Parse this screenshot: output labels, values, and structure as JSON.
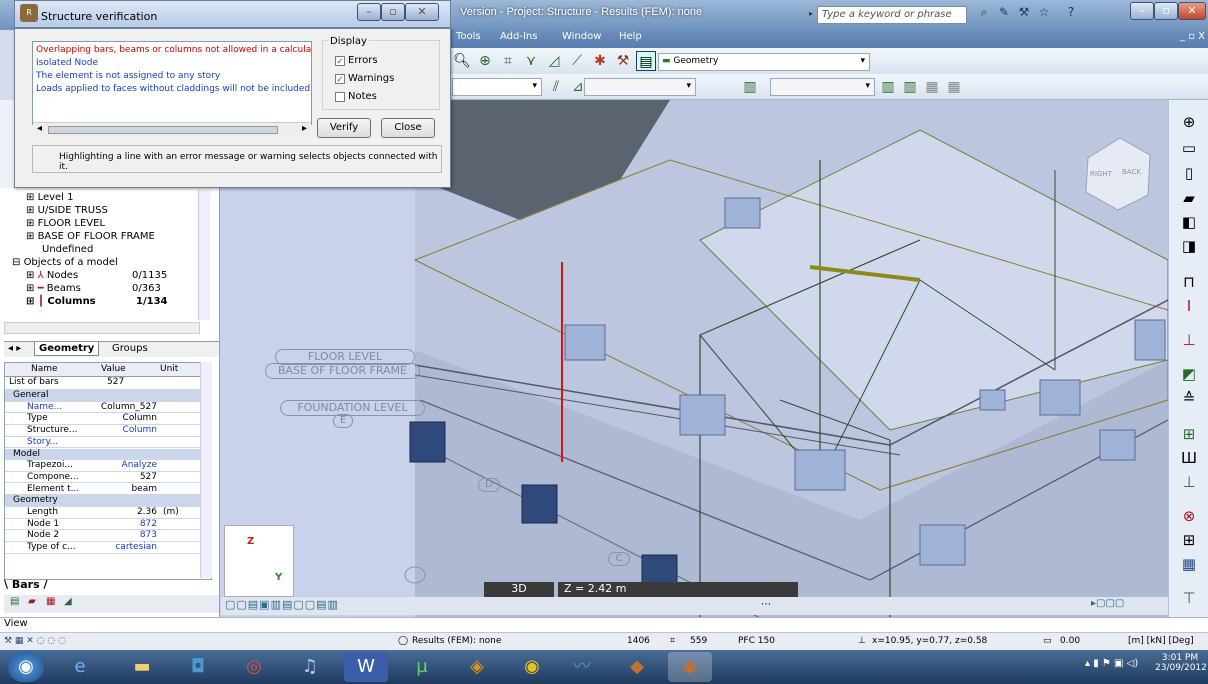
{
  "app": {
    "title": "Version - Project: Structure - Results (FEM): none",
    "search_placeholder": "Type a keyword or phrase"
  },
  "menubar": {
    "items": [
      "Tools",
      "Add-Ins",
      "Window",
      "Help"
    ],
    "mdi_controls": "_ ▫ X"
  },
  "toolbar": {
    "view_combo": "Geometry"
  },
  "dialog": {
    "title": "Structure verification",
    "messages": [
      {
        "text": "Overlapping bars, beams or columns not allowed in a calculation m",
        "color": "#cc0000"
      },
      {
        "text": "Isolated Node",
        "color": "#1a3cc8"
      },
      {
        "text": "The element is not assigned to any story",
        "color": "#1a3cc8"
      },
      {
        "text": "Loads applied to faces without claddings will not be included in cal",
        "color": "#1a3cc8"
      }
    ],
    "display_label": "Display",
    "options": [
      {
        "label": "Errors",
        "checked": true
      },
      {
        "label": "Warnings",
        "checked": true
      },
      {
        "label": "Notes",
        "checked": false
      }
    ],
    "verify_label": "Verify",
    "close_label": "Close",
    "hint": "Highlighting a line with an error message or warning selects objects connected with it."
  },
  "tree": {
    "stories": [
      "Level 1",
      "U/SIDE TRUSS",
      "FLOOR LEVEL",
      "BASE OF FLOOR FRAME",
      "Undefined"
    ],
    "objects_label": "Objects of a model",
    "objects": [
      {
        "label": "Nodes",
        "value": "0/1135"
      },
      {
        "label": "Beams",
        "value": "0/363"
      },
      {
        "label": "Columns",
        "value": "1/134"
      }
    ],
    "tab_geometry": "Geometry",
    "tab_groups": "Groups"
  },
  "props": {
    "headers": {
      "name": "Name",
      "value": "Value",
      "unit": "Unit"
    },
    "list_label": "List of bars",
    "list_value": "527",
    "rows": [
      {
        "section": "General"
      },
      {
        "name": "Name...",
        "value": "Column_527",
        "unit": ""
      },
      {
        "name": "Type",
        "value": "Column",
        "unit": ""
      },
      {
        "name": "Structure...",
        "value": "Column",
        "unit": ""
      },
      {
        "name": "Story...",
        "value": "",
        "unit": ""
      },
      {
        "section": "Model"
      },
      {
        "name": "Trapezoi...",
        "value": "Analyze",
        "unit": ""
      },
      {
        "name": "Compone...",
        "value": "527",
        "unit": ""
      },
      {
        "name": "Element t...",
        "value": "beam",
        "unit": ""
      },
      {
        "section": "Geometry"
      },
      {
        "name": "Length",
        "value": "2.36",
        "unit": "(m)"
      },
      {
        "name": "Node 1",
        "value": "872",
        "unit": ""
      },
      {
        "name": "Node 2",
        "value": "873",
        "unit": ""
      },
      {
        "name": "Type of c...",
        "value": "cartesian",
        "unit": ""
      }
    ],
    "bars_tab": "Bars"
  },
  "viewport": {
    "mode": "3D",
    "z_level": "Z = 2.42 m",
    "story_labels": [
      "FLOOR LEVEL",
      "BASE OF FLOOR FRAME",
      "FOUNDATION LEVEL"
    ],
    "axis_labels": [
      "E",
      "D",
      "C"
    ],
    "cube_labels": [
      "RIGHT",
      "BACK"
    ],
    "axis": {
      "z": "Z",
      "y": "Y"
    }
  },
  "view_label": "View",
  "status": {
    "results": "Results (FEM): none",
    "node_count": "1406",
    "bar_count": "559",
    "section": "PFC 150",
    "coords": "x=10.95, y=0.77, z=0.58",
    "value": "0.00",
    "units": "[m] [kN] [Deg]"
  },
  "clock": {
    "time": "3:01 PM",
    "date": "23/09/2012"
  },
  "colors": {
    "error": "#cc0000",
    "warning": "#1a3cc8",
    "accent": "#5a7fae"
  }
}
